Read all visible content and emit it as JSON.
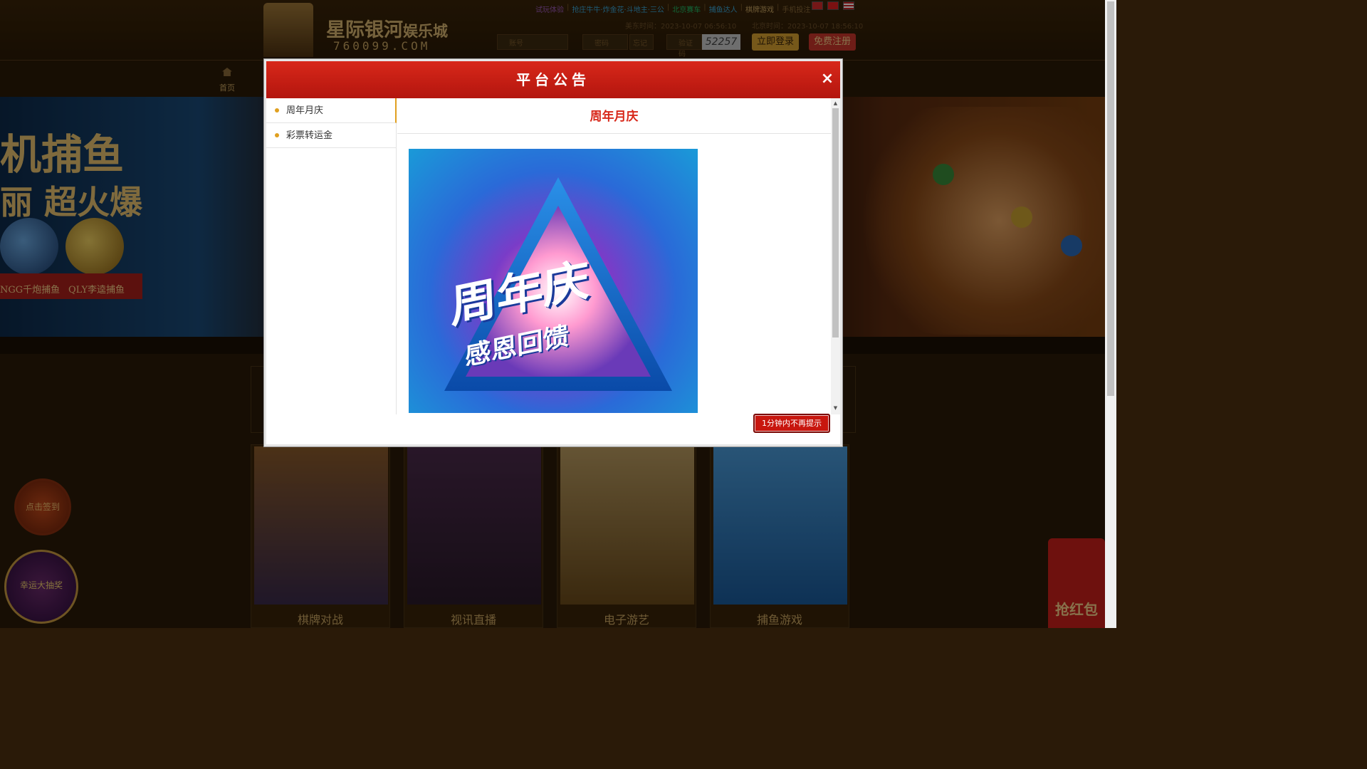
{
  "header": {
    "logo_title": "星际银河",
    "logo_suffix": "娱乐城",
    "logo_url": "760099.COM",
    "top_links": [
      "试玩体验",
      "抢庄牛牛·炸金花·斗地主·三公",
      "北京赛车",
      "捕鱼达人",
      "棋牌游戏",
      "手机投注"
    ],
    "us_time": "美东时间：2023-10-07 06:56:10",
    "bj_time": "北京时间：2023-10-07 18:56:10",
    "account_placeholder": "账号",
    "password_placeholder": "密码",
    "forgot_label": "忘记",
    "captcha_placeholder": "验证码",
    "captcha_value": "52257",
    "login_button": "立即登录",
    "register_button": "免费注册"
  },
  "nav": {
    "home_label": "首页"
  },
  "banner": {
    "line1": "机捕鱼",
    "line2": "丽 超火爆",
    "tag_a": "NGG千炮捕鱼",
    "tag_b": "QLY李逵捕鱼"
  },
  "cards": [
    {
      "label": "棋牌对战"
    },
    {
      "label": "视讯直播"
    },
    {
      "label": "电子游艺"
    },
    {
      "label": "捕鱼游戏"
    }
  ],
  "float": {
    "signin": "点击签到",
    "wheel": "幸运大抽奖",
    "redpack": "抢红包"
  },
  "modal": {
    "title": "平台公告",
    "close": "×",
    "tabs": [
      {
        "label": "周年月庆",
        "active": true
      },
      {
        "label": "彩票转运金",
        "active": false
      }
    ],
    "content_title": "周年月庆",
    "poster_line1": "周年庆",
    "poster_line2": "感恩回馈",
    "dismiss_button": "1分钟内不再提示"
  },
  "colors": {
    "modal_header": "#c81c12",
    "accent_gold": "#e0a020",
    "content_title": "#d8281a"
  }
}
